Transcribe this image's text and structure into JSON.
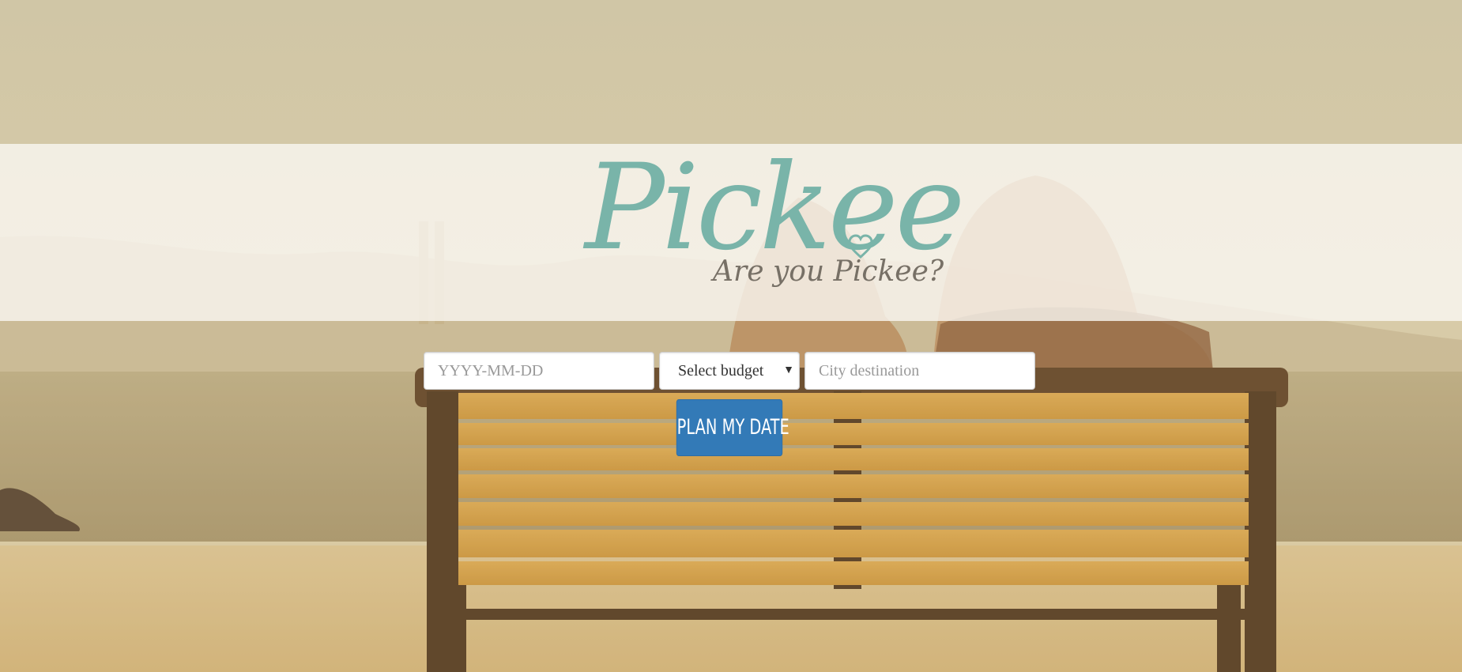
{
  "brand": {
    "name": "Pickee",
    "tagline": "Are you Pickee?",
    "logo_color": "#79b4a9"
  },
  "form": {
    "date_placeholder": "YYYY-MM-DD",
    "budget_selected": "Select budget",
    "city_placeholder": "City destination",
    "submit_label": "PLAN MY DATE"
  },
  "colors": {
    "button": "#337ab7",
    "banner": "#faf8f2"
  },
  "icons": {
    "heart": "heart-icon",
    "dropdown": "caret-down-icon"
  }
}
